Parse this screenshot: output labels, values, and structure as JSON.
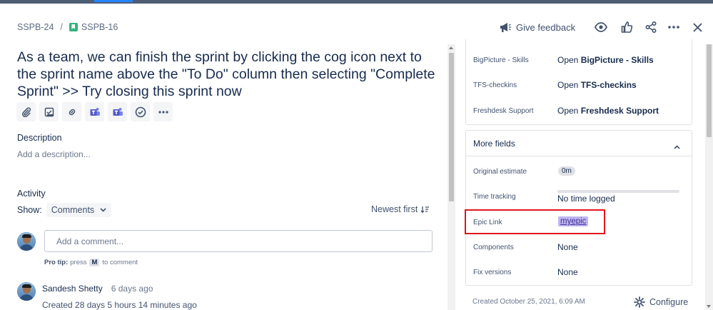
{
  "breadcrumb": {
    "parent": "SSPB-24",
    "separator": "/",
    "current": "SSPB-16"
  },
  "header": {
    "feedback_label": "Give feedback",
    "icons": [
      "megaphone-icon",
      "eye-icon",
      "like-icon",
      "share-icon",
      "more-icon",
      "close-icon"
    ]
  },
  "issue": {
    "title": "As a team, we can finish the sprint by clicking the cog icon next to the sprint name above the \"To Do\" column then selecting \"Complete Sprint\" >> Try closing this sprint now",
    "toolbar_icons": [
      "attach-icon",
      "child-issue-icon",
      "link-icon",
      "teams-icon",
      "teams-icon",
      "check-circle-icon",
      "more-icon"
    ]
  },
  "description": {
    "label": "Description",
    "placeholder": "Add a description..."
  },
  "activity": {
    "label": "Activity",
    "show_label": "Show:",
    "filter_value": "Comments",
    "sort_label": "Newest first",
    "comment_placeholder": "Add a comment...",
    "protip_bold": "Pro tip:",
    "protip_press": "press",
    "protip_key": "M",
    "protip_rest": "to comment"
  },
  "history": {
    "author": "Sandesh Shetty",
    "time": "6 days ago",
    "entry": "Created 28 days 5 hours 14 minutes ago"
  },
  "apps": [
    {
      "name": "BigPicture - Skills",
      "prefix": "Open",
      "target": "BigPicture - Skills"
    },
    {
      "name": "TFS-checkins",
      "prefix": "Open",
      "target": "TFS-checkins"
    },
    {
      "name": "Freshdesk Support",
      "prefix": "Open",
      "target": "Freshdesk Support"
    }
  ],
  "more_fields": {
    "header": "More fields",
    "original_estimate": {
      "label": "Original estimate",
      "value": "0m"
    },
    "time_tracking": {
      "label": "Time tracking",
      "value": "No time logged",
      "progress": 0
    },
    "epic_link": {
      "label": "Epic Link",
      "value": "myepic"
    },
    "components": {
      "label": "Components",
      "value": "None"
    },
    "fix_versions": {
      "label": "Fix versions",
      "value": "None"
    }
  },
  "footer": {
    "created": "Created October 25, 2021, 6:09 AM",
    "configure_label": "Configure"
  },
  "colors": {
    "highlight": "#e3161a",
    "epic": "#c0b6f2",
    "story": "#36b37e"
  }
}
